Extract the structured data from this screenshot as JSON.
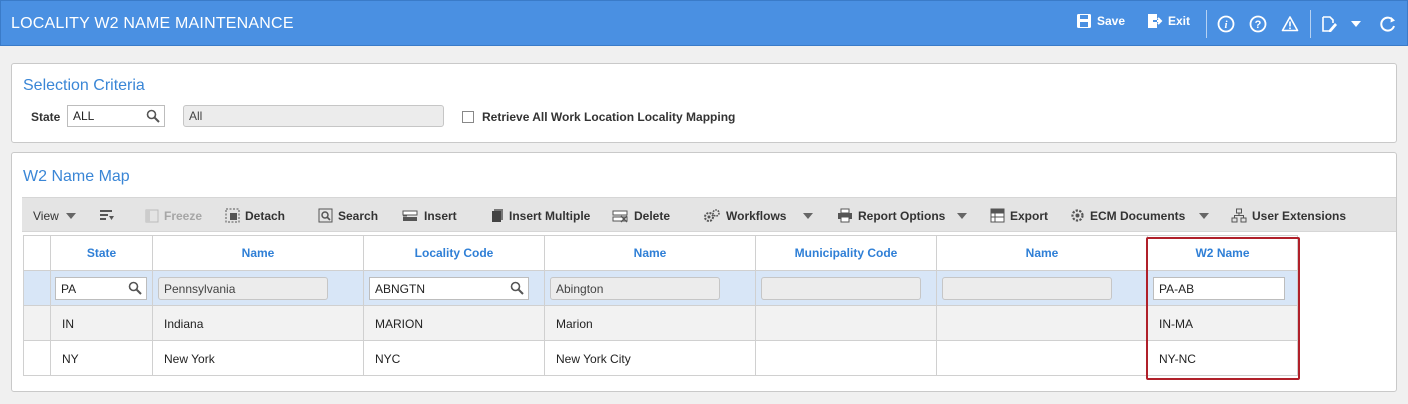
{
  "header": {
    "title": "LOCALITY W2 NAME MAINTENANCE",
    "save_label": "Save",
    "exit_label": "Exit",
    "icons": [
      "save-icon",
      "exit-icon",
      "info-icon",
      "help-icon",
      "warning-icon",
      "edit-icon",
      "chevron-down-icon",
      "refresh-icon"
    ]
  },
  "selection": {
    "title": "Selection Criteria",
    "state_label": "State",
    "state_value": "ALL",
    "state_desc": "All",
    "retrieve_label": "Retrieve All Work Location Locality Mapping"
  },
  "map": {
    "title": "W2 Name Map",
    "toolbar": {
      "view": "View",
      "freeze": "Freeze",
      "detach": "Detach",
      "search": "Search",
      "insert": "Insert",
      "insert_multiple": "Insert Multiple",
      "delete": "Delete",
      "workflows": "Workflows",
      "report_options": "Report Options",
      "export": "Export",
      "ecm_documents": "ECM Documents",
      "user_extensions": "User Extensions"
    },
    "columns": [
      "State",
      "Name",
      "Locality Code",
      "Name",
      "Municipality Code",
      "Name",
      "W2 Name"
    ],
    "rows": [
      {
        "state": "PA",
        "state_name": "Pennsylvania",
        "locality_code": "ABNGTN",
        "locality_name": "Abington",
        "municipality_code": "",
        "municipality_name": "",
        "w2_name": "PA-AB"
      },
      {
        "state": "IN",
        "state_name": "Indiana",
        "locality_code": "MARION",
        "locality_name": "Marion",
        "municipality_code": "",
        "municipality_name": "",
        "w2_name": "IN-MA"
      },
      {
        "state": "NY",
        "state_name": "New York",
        "locality_code": "NYC",
        "locality_name": "New York City",
        "municipality_code": "",
        "municipality_name": "",
        "w2_name": "NY-NC"
      }
    ]
  },
  "colors": {
    "header_bg": "#4a90e2",
    "title_blue": "#3a86d6",
    "selected_row": "#d8e6f7",
    "highlight_border": "#b0202a"
  }
}
